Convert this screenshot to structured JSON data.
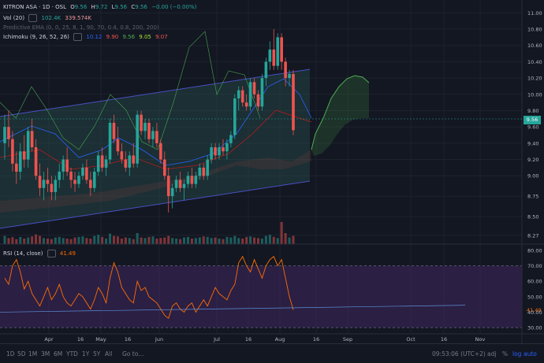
{
  "main_legend": {
    "symbol": "KITRON ASA · 1D · OSL",
    "o_label": "O",
    "o_val": "9.56",
    "h_label": "H",
    "h_val": "9.72",
    "l_label": "L",
    "l_val": "9.56",
    "c_label": "C",
    "c_val": "9.56",
    "change": "−0.00 (−0.00%)"
  },
  "vol_legend": {
    "label": "Vol (20)",
    "v1": "102.4K",
    "v2": "339.574K"
  },
  "ema_legend": {
    "label": "Predictive EMA (0, 0, 25, 8, 1, 90, 70, 0.4, 0.8, 200, 200)"
  },
  "ichimoku_legend": {
    "label": "Ichimoku (9, 26, 52, 26)",
    "v1": "10.12",
    "v2": "9.90",
    "v3": "9.56",
    "v4": "9.05",
    "v5": "9.07"
  },
  "rsi_legend": {
    "label": "RSI (14, close)",
    "value": "41.49"
  },
  "last_price": "9.56",
  "colors": {
    "up": "#26a69a",
    "down": "#ef5350",
    "cloud": "#a6e22e",
    "tenkan": "#2962ff",
    "kijun": "#b71c1c",
    "rsi_line": "#ff6d00",
    "rsi_band": "#4a2a6e",
    "channel": "#4a4fc4",
    "channel_fill": "#2a5b57",
    "lagging": "#4caf50"
  },
  "bottom_bar": {
    "timeframes": [
      "1D",
      "5D",
      "1M",
      "3M",
      "6M",
      "YTD",
      "1Y",
      "5Y",
      "All"
    ],
    "goto": "Go to...",
    "time": "09:53:06 (UTC+2)",
    "pct": "%",
    "log": "log",
    "auto": "auto",
    "adj": "adj"
  },
  "chart_data": {
    "type": "candlestick",
    "title": "KITRON ASA · 1D · OSL",
    "x_ticks": [
      "Apr",
      "16",
      "May",
      "16",
      "Jun",
      "Jul",
      "16",
      "Aug",
      "16",
      "Sep",
      "Oct",
      "16",
      "Nov"
    ],
    "y_ticks": [
      "11.00",
      "10.80",
      "10.60",
      "10.40",
      "10.20",
      "10.00",
      "9.80",
      "9.60",
      "9.40",
      "9.20",
      "9.00",
      "8.75",
      "8.50",
      "8.27"
    ],
    "y_range": [
      8.2,
      11.1
    ],
    "rsi_ticks": [
      "80.00",
      "70.00",
      "60.00",
      "50.00",
      "40.00",
      "30.00"
    ],
    "rsi_range": [
      28,
      82
    ],
    "rsi_band": [
      30,
      70
    ],
    "rsi_last": 41.49,
    "candles": [
      {
        "o": 9.4,
        "h": 9.75,
        "l": 9.2,
        "c": 9.6
      },
      {
        "o": 9.6,
        "h": 9.8,
        "l": 9.35,
        "c": 9.45
      },
      {
        "o": 9.45,
        "h": 9.55,
        "l": 9.05,
        "c": 9.15
      },
      {
        "o": 9.15,
        "h": 9.3,
        "l": 8.9,
        "c": 9.05
      },
      {
        "o": 9.05,
        "h": 9.4,
        "l": 8.95,
        "c": 9.3
      },
      {
        "o": 9.3,
        "h": 9.5,
        "l": 9.1,
        "c": 9.2
      },
      {
        "o": 9.2,
        "h": 9.6,
        "l": 9.1,
        "c": 9.55
      },
      {
        "o": 9.55,
        "h": 9.7,
        "l": 9.3,
        "c": 9.35
      },
      {
        "o": 9.35,
        "h": 9.45,
        "l": 8.95,
        "c": 9.0
      },
      {
        "o": 9.0,
        "h": 9.15,
        "l": 8.75,
        "c": 8.85
      },
      {
        "o": 8.85,
        "h": 9.05,
        "l": 8.7,
        "c": 8.95
      },
      {
        "o": 8.95,
        "h": 9.1,
        "l": 8.8,
        "c": 8.9
      },
      {
        "o": 8.9,
        "h": 9.0,
        "l": 8.7,
        "c": 8.8
      },
      {
        "o": 8.8,
        "h": 9.0,
        "l": 8.7,
        "c": 8.95
      },
      {
        "o": 8.95,
        "h": 9.15,
        "l": 8.85,
        "c": 9.05
      },
      {
        "o": 9.05,
        "h": 9.25,
        "l": 8.95,
        "c": 9.2
      },
      {
        "o": 9.2,
        "h": 9.35,
        "l": 9.0,
        "c": 9.05
      },
      {
        "o": 9.05,
        "h": 9.1,
        "l": 8.85,
        "c": 8.95
      },
      {
        "o": 8.95,
        "h": 9.05,
        "l": 8.8,
        "c": 8.9
      },
      {
        "o": 8.9,
        "h": 9.05,
        "l": 8.85,
        "c": 9.0
      },
      {
        "o": 9.0,
        "h": 9.15,
        "l": 8.95,
        "c": 9.1
      },
      {
        "o": 9.1,
        "h": 9.2,
        "l": 8.9,
        "c": 8.95
      },
      {
        "o": 8.95,
        "h": 9.05,
        "l": 8.75,
        "c": 8.85
      },
      {
        "o": 8.85,
        "h": 9.1,
        "l": 8.8,
        "c": 9.05
      },
      {
        "o": 9.05,
        "h": 9.3,
        "l": 9.0,
        "c": 9.25
      },
      {
        "o": 9.25,
        "h": 9.35,
        "l": 9.05,
        "c": 9.1
      },
      {
        "o": 9.1,
        "h": 9.25,
        "l": 9.0,
        "c": 9.2
      },
      {
        "o": 9.2,
        "h": 9.7,
        "l": 9.15,
        "c": 9.65
      },
      {
        "o": 9.65,
        "h": 9.75,
        "l": 9.4,
        "c": 9.45
      },
      {
        "o": 9.45,
        "h": 9.6,
        "l": 9.25,
        "c": 9.3
      },
      {
        "o": 9.3,
        "h": 9.4,
        "l": 9.15,
        "c": 9.2
      },
      {
        "o": 9.2,
        "h": 9.3,
        "l": 9.05,
        "c": 9.1
      },
      {
        "o": 9.1,
        "h": 9.3,
        "l": 9.0,
        "c": 9.25
      },
      {
        "o": 9.25,
        "h": 9.4,
        "l": 9.1,
        "c": 9.15
      },
      {
        "o": 9.15,
        "h": 9.8,
        "l": 9.1,
        "c": 9.75
      },
      {
        "o": 9.75,
        "h": 9.8,
        "l": 9.5,
        "c": 9.55
      },
      {
        "o": 9.55,
        "h": 9.7,
        "l": 9.45,
        "c": 9.65
      },
      {
        "o": 9.65,
        "h": 9.7,
        "l": 9.4,
        "c": 9.45
      },
      {
        "o": 9.45,
        "h": 9.6,
        "l": 9.35,
        "c": 9.55
      },
      {
        "o": 9.55,
        "h": 9.65,
        "l": 9.35,
        "c": 9.4
      },
      {
        "o": 9.4,
        "h": 9.45,
        "l": 9.15,
        "c": 9.2
      },
      {
        "o": 9.2,
        "h": 9.3,
        "l": 8.95,
        "c": 9.0
      },
      {
        "o": 9.0,
        "h": 9.1,
        "l": 8.55,
        "c": 8.75
      },
      {
        "o": 8.75,
        "h": 8.9,
        "l": 8.6,
        "c": 8.85
      },
      {
        "o": 8.85,
        "h": 9.0,
        "l": 8.8,
        "c": 8.95
      },
      {
        "o": 8.95,
        "h": 9.05,
        "l": 8.8,
        "c": 8.85
      },
      {
        "o": 8.85,
        "h": 8.95,
        "l": 8.7,
        "c": 8.9
      },
      {
        "o": 8.9,
        "h": 9.05,
        "l": 8.85,
        "c": 9.0
      },
      {
        "o": 9.0,
        "h": 9.1,
        "l": 8.85,
        "c": 8.9
      },
      {
        "o": 8.9,
        "h": 9.05,
        "l": 8.85,
        "c": 9.0
      },
      {
        "o": 9.0,
        "h": 9.15,
        "l": 8.95,
        "c": 9.1
      },
      {
        "o": 9.1,
        "h": 9.15,
        "l": 8.95,
        "c": 9.0
      },
      {
        "o": 9.0,
        "h": 9.25,
        "l": 8.95,
        "c": 9.2
      },
      {
        "o": 9.2,
        "h": 9.4,
        "l": 9.15,
        "c": 9.35
      },
      {
        "o": 9.35,
        "h": 9.4,
        "l": 9.2,
        "c": 9.25
      },
      {
        "o": 9.25,
        "h": 9.4,
        "l": 9.2,
        "c": 9.35
      },
      {
        "o": 9.35,
        "h": 9.45,
        "l": 9.25,
        "c": 9.3
      },
      {
        "o": 9.3,
        "h": 9.45,
        "l": 9.2,
        "c": 9.4
      },
      {
        "o": 9.4,
        "h": 9.55,
        "l": 9.35,
        "c": 9.5
      },
      {
        "o": 9.5,
        "h": 10.0,
        "l": 9.45,
        "c": 9.95
      },
      {
        "o": 9.95,
        "h": 10.1,
        "l": 9.8,
        "c": 10.05
      },
      {
        "o": 10.05,
        "h": 10.1,
        "l": 9.85,
        "c": 9.9
      },
      {
        "o": 9.9,
        "h": 10.0,
        "l": 9.8,
        "c": 9.85
      },
      {
        "o": 9.85,
        "h": 10.2,
        "l": 9.8,
        "c": 10.15
      },
      {
        "o": 10.15,
        "h": 10.2,
        "l": 9.95,
        "c": 10.0
      },
      {
        "o": 10.0,
        "h": 10.05,
        "l": 9.8,
        "c": 9.85
      },
      {
        "o": 9.85,
        "h": 10.25,
        "l": 9.8,
        "c": 10.2
      },
      {
        "o": 10.2,
        "h": 10.45,
        "l": 10.1,
        "c": 10.4
      },
      {
        "o": 10.4,
        "h": 10.65,
        "l": 10.3,
        "c": 10.55
      },
      {
        "o": 10.55,
        "h": 10.8,
        "l": 10.3,
        "c": 10.35
      },
      {
        "o": 10.35,
        "h": 10.75,
        "l": 10.3,
        "c": 10.7
      },
      {
        "o": 10.7,
        "h": 10.75,
        "l": 10.3,
        "c": 10.4
      },
      {
        "o": 10.4,
        "h": 10.45,
        "l": 10.1,
        "c": 10.2
      },
      {
        "o": 10.2,
        "h": 10.3,
        "l": 10.1,
        "c": 10.25
      },
      {
        "o": 10.25,
        "h": 10.3,
        "l": 9.5,
        "c": 9.56
      }
    ],
    "volumes": [
      30,
      22,
      25,
      18,
      26,
      20,
      24,
      28,
      35,
      30,
      22,
      20,
      18,
      24,
      26,
      22,
      20,
      18,
      24,
      26,
      28,
      22,
      20,
      30,
      34,
      26,
      20,
      38,
      30,
      28,
      20,
      24,
      22,
      18,
      40,
      24,
      22,
      26,
      28,
      20,
      22,
      24,
      30,
      22,
      20,
      18,
      24,
      26,
      20,
      22,
      24,
      28,
      26,
      22,
      24,
      20,
      18,
      26,
      24,
      30,
      22,
      20,
      26,
      28,
      24,
      22,
      20,
      30,
      34,
      26,
      22,
      80,
      40,
      24,
      30
    ]
  }
}
